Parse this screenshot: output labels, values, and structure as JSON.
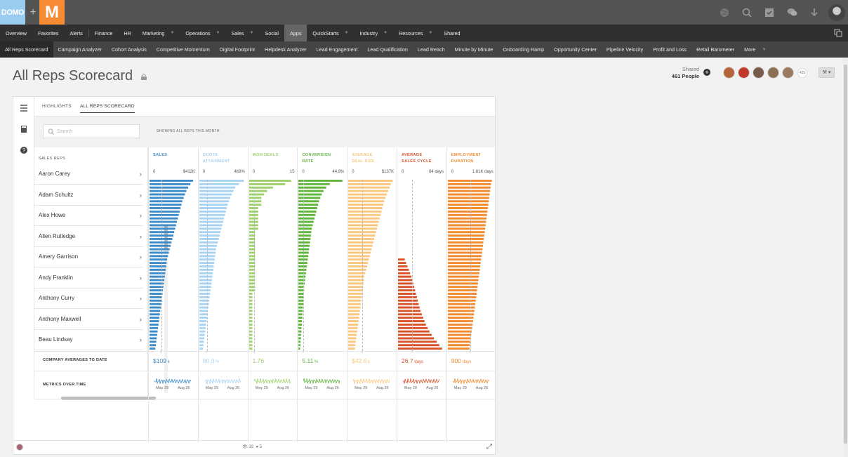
{
  "brand": {
    "logo_text": "DOMO",
    "plus": "+",
    "app_letter": "M"
  },
  "top_icons": [
    "globe-icon",
    "search-icon",
    "tasks-icon",
    "chat-icon",
    "download-icon"
  ],
  "nav1": {
    "items": [
      {
        "label": "Overview"
      },
      {
        "label": "Favorites"
      },
      {
        "label": "Alerts"
      },
      {
        "label": "Finance"
      },
      {
        "label": "HR"
      },
      {
        "label": "Marketing",
        "caret": true
      },
      {
        "label": "Operations",
        "caret": true
      },
      {
        "label": "Sales",
        "caret": true
      },
      {
        "label": "Social"
      },
      {
        "label": "Apps",
        "active": true
      },
      {
        "label": "QuickStarts",
        "caret": true
      },
      {
        "label": "Industry",
        "caret": true
      },
      {
        "label": "Resources",
        "caret": true
      },
      {
        "label": "Shared"
      }
    ]
  },
  "nav2": {
    "items": [
      {
        "label": "All Reps Scorecard",
        "active": true
      },
      {
        "label": "Campaign Analyzer"
      },
      {
        "label": "Cohort Analysis"
      },
      {
        "label": "Competitive Momentum"
      },
      {
        "label": "Digital Footprint"
      },
      {
        "label": "Helpdesk Analyzer"
      },
      {
        "label": "Lead Engagement"
      },
      {
        "label": "Lead Qualification"
      },
      {
        "label": "Lead Reach"
      },
      {
        "label": "Minute by Minute"
      },
      {
        "label": "Onboarding Ramp"
      },
      {
        "label": "Opportunity Center"
      },
      {
        "label": "Pipeline Velocity"
      },
      {
        "label": "Profit and Loss"
      },
      {
        "label": "Retail Barometer"
      },
      {
        "label": "More"
      }
    ]
  },
  "page": {
    "title": "All Reps Scorecard"
  },
  "share": {
    "label": "Shared",
    "people": "461 People",
    "more_count": "455"
  },
  "card": {
    "tabs": [
      {
        "label": "HIGHLIGHTS"
      },
      {
        "label": "ALL REPS SCORECARD",
        "active": true
      }
    ],
    "search_placeholder": "Search",
    "showing_text": "SHOWING ALL REPS THIS MONTH",
    "sales_reps_header": "SALES REPS",
    "reps": [
      "Aaron Carey",
      "Adam Schultz",
      "Alex Howe",
      "Allen Rutledge",
      "Amery Garrison",
      "Andy Franklin",
      "Anthony Curry",
      "Anthony Maxwell",
      "Beau Lindsay"
    ],
    "row_labels": {
      "averages": "COMPANY AVERAGES TO DATE",
      "metrics_over_time": "METRICS OVER TIME"
    },
    "spark_labels": {
      "start": "May 29",
      "end": "Aug 26"
    },
    "footer": {
      "views": "33",
      "comments": "5"
    }
  },
  "metrics": [
    {
      "title1": "SALES",
      "title2": "",
      "color": "#3d8cc9",
      "min": "0",
      "max": "$412K",
      "avg": "$109",
      "avg_unit": "k"
    },
    {
      "title1": "QUOTA",
      "title2": "ATTAINMENT",
      "color": "#a9d3f2",
      "min": "0",
      "max": "469%",
      "avg": "80.3",
      "avg_unit": "%"
    },
    {
      "title1": "WON DEALS",
      "title2": "",
      "color": "#9ed06c",
      "min": "0",
      "max": "15",
      "avg": "1.76",
      "avg_unit": ""
    },
    {
      "title1": "CONVERSION",
      "title2": "RATE",
      "color": "#5fb63b",
      "min": "0",
      "max": "44.8%",
      "avg": "5.11",
      "avg_unit": "%"
    },
    {
      "title1": "AVERAGE",
      "title2": "DEAL SIZE",
      "color": "#f9c77e",
      "min": "0",
      "max": "$137K",
      "avg": "$42.6",
      "avg_unit": "k"
    },
    {
      "title1": "AVERAGE",
      "title2": "SALES CYCLE",
      "color": "#d9532a",
      "min": "0",
      "max": "84 days",
      "avg": "26.7",
      "avg_unit": "days"
    },
    {
      "title1": "EMPLOYMENT",
      "title2": "DURATION",
      "color": "#f38a2d",
      "min": "0",
      "max": "1.81K days",
      "avg": "900",
      "avg_unit": "days"
    }
  ],
  "chart_data": [
    {
      "type": "bar",
      "ylabel": "SALES",
      "max_label": "$412K",
      "orientation": "horizontal",
      "note": "values as fraction of max, sorted",
      "values": [
        0.97,
        0.91,
        0.86,
        0.82,
        0.79,
        0.76,
        0.73,
        0.71,
        0.69,
        0.67,
        0.65,
        0.63,
        0.61,
        0.59,
        0.57,
        0.55,
        0.53,
        0.51,
        0.49,
        0.47,
        0.45,
        0.43,
        0.41,
        0.39,
        0.38,
        0.37,
        0.36,
        0.35,
        0.34,
        0.33,
        0.32,
        0.31,
        0.3,
        0.29,
        0.28,
        0.27,
        0.26,
        0.25,
        0.24,
        0.23,
        0.22,
        0.21,
        0.2,
        0.19,
        0.18,
        0.17,
        0.16,
        0.15,
        0.14,
        0.13
      ]
    },
    {
      "type": "bar",
      "ylabel": "QUOTA ATTAINMENT",
      "max_label": "469%",
      "orientation": "horizontal",
      "values": [
        0.99,
        0.88,
        0.8,
        0.76,
        0.72,
        0.69,
        0.66,
        0.63,
        0.61,
        0.59,
        0.57,
        0.55,
        0.53,
        0.51,
        0.49,
        0.47,
        0.45,
        0.43,
        0.41,
        0.39,
        0.37,
        0.36,
        0.35,
        0.34,
        0.33,
        0.32,
        0.31,
        0.3,
        0.29,
        0.28,
        0.27,
        0.26,
        0.25,
        0.24,
        0.23,
        0.22,
        0.21,
        0.2,
        0.19,
        0.18,
        0.17,
        0.16,
        0.15,
        0.14,
        0.13,
        0.12,
        0.11,
        0.1,
        0.09,
        0.08
      ]
    },
    {
      "type": "bar",
      "ylabel": "WON DEALS",
      "max_label": "15",
      "orientation": "horizontal",
      "values": [
        0.93,
        0.8,
        0.53,
        0.4,
        0.33,
        0.27,
        0.27,
        0.27,
        0.2,
        0.2,
        0.2,
        0.2,
        0.2,
        0.2,
        0.2,
        0.13,
        0.13,
        0.13,
        0.13,
        0.13,
        0.13,
        0.13,
        0.13,
        0.13,
        0.13,
        0.13,
        0.13,
        0.13,
        0.13,
        0.13,
        0.13,
        0.13,
        0.13,
        0.07,
        0.07,
        0.07,
        0.07,
        0.07,
        0.07,
        0.07,
        0.07,
        0.07,
        0.07,
        0.07,
        0.07,
        0.07,
        0.07,
        0.07,
        0.07,
        0.07
      ]
    },
    {
      "type": "bar",
      "ylabel": "CONVERSION RATE",
      "max_label": "44.8%",
      "orientation": "horizontal",
      "values": [
        0.98,
        0.7,
        0.62,
        0.56,
        0.52,
        0.49,
        0.46,
        0.44,
        0.42,
        0.4,
        0.38,
        0.36,
        0.34,
        0.32,
        0.3,
        0.29,
        0.28,
        0.27,
        0.26,
        0.25,
        0.24,
        0.23,
        0.22,
        0.21,
        0.2,
        0.19,
        0.18,
        0.17,
        0.16,
        0.15,
        0.14,
        0.13,
        0.13,
        0.12,
        0.12,
        0.11,
        0.11,
        0.1,
        0.1,
        0.09,
        0.09,
        0.08,
        0.08,
        0.07,
        0.07,
        0.06,
        0.06,
        0.05,
        0.05,
        0.04
      ]
    },
    {
      "type": "bar",
      "ylabel": "AVERAGE DEAL SIZE",
      "max_label": "$137K",
      "orientation": "horizontal",
      "values": [
        0.99,
        0.95,
        0.92,
        0.89,
        0.86,
        0.83,
        0.8,
        0.78,
        0.76,
        0.74,
        0.72,
        0.7,
        0.68,
        0.66,
        0.64,
        0.62,
        0.6,
        0.58,
        0.56,
        0.54,
        0.52,
        0.5,
        0.48,
        0.46,
        0.44,
        0.42,
        0.4,
        0.38,
        0.36,
        0.35,
        0.34,
        0.33,
        0.32,
        0.31,
        0.3,
        0.29,
        0.28,
        0.27,
        0.26,
        0.25,
        0.24,
        0.23,
        0.22,
        0.21,
        0.2,
        0.19,
        0.18,
        0.17,
        0.16,
        0.15
      ]
    },
    {
      "type": "bar",
      "ylabel": "AVERAGE SALES CYCLE",
      "max_label": "84 days",
      "orientation": "horizontal",
      "values": [
        0,
        0,
        0,
        0,
        0,
        0,
        0,
        0,
        0,
        0,
        0,
        0,
        0,
        0,
        0,
        0,
        0,
        0,
        0,
        0,
        0,
        0,
        0,
        0.15,
        0.18,
        0.21,
        0.24,
        0.27,
        0.3,
        0.32,
        0.34,
        0.36,
        0.38,
        0.4,
        0.42,
        0.44,
        0.46,
        0.48,
        0.5,
        0.53,
        0.56,
        0.59,
        0.62,
        0.66,
        0.7,
        0.75,
        0.8,
        0.86,
        0.92,
        0.98
      ]
    },
    {
      "type": "bar",
      "ylabel": "EMPLOYMENT DURATION",
      "max_label": "1.81K days",
      "orientation": "horizontal",
      "values": [
        0.98,
        0.96,
        0.95,
        0.94,
        0.93,
        0.92,
        0.91,
        0.9,
        0.89,
        0.88,
        0.87,
        0.86,
        0.85,
        0.84,
        0.83,
        0.82,
        0.81,
        0.8,
        0.79,
        0.78,
        0.77,
        0.76,
        0.75,
        0.74,
        0.73,
        0.72,
        0.71,
        0.7,
        0.69,
        0.68,
        0.67,
        0.66,
        0.65,
        0.64,
        0.63,
        0.62,
        0.61,
        0.6,
        0.59,
        0.58,
        0.57,
        0.56,
        0.55,
        0.54,
        0.53,
        0.52,
        0.51,
        0.5,
        0.49,
        0.48
      ]
    }
  ]
}
